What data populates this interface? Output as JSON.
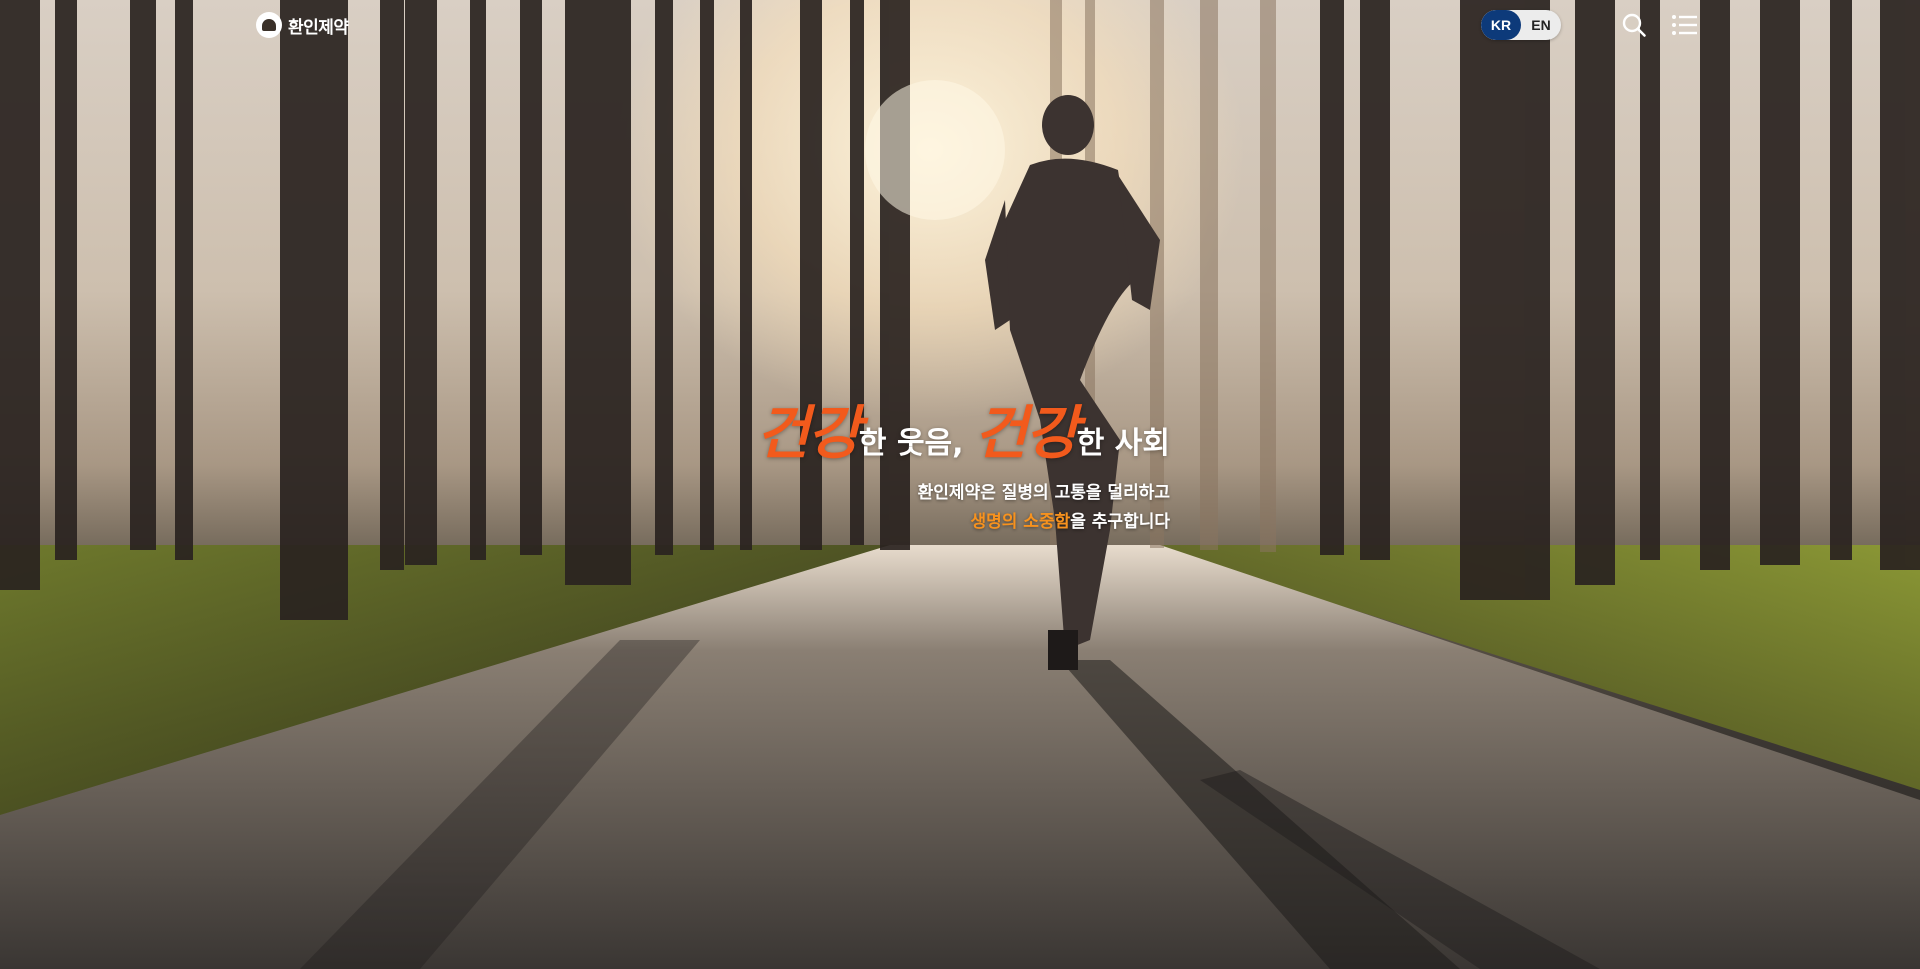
{
  "header": {
    "logo_text": "환인제약",
    "logo_icon": "hwanin-logo-icon",
    "lang": {
      "kr_label": "KR",
      "en_label": "EN",
      "active": "KR",
      "active_color": "#0d3a7a"
    },
    "search_icon": "search-icon",
    "menu_icon": "menu-icon"
  },
  "hero": {
    "headline": {
      "accent_1": "건강",
      "text_1": "한 웃음,",
      "accent_2": "건강",
      "text_2": "한 사회",
      "accent_color": "#f25a1c"
    },
    "subline_1": "환인제약은 질병의 고통을 덜리하고",
    "subline_2_highlight": "생명의 소중함",
    "subline_2_rest": "을 추구합니다",
    "highlight_color": "#f7921e"
  }
}
